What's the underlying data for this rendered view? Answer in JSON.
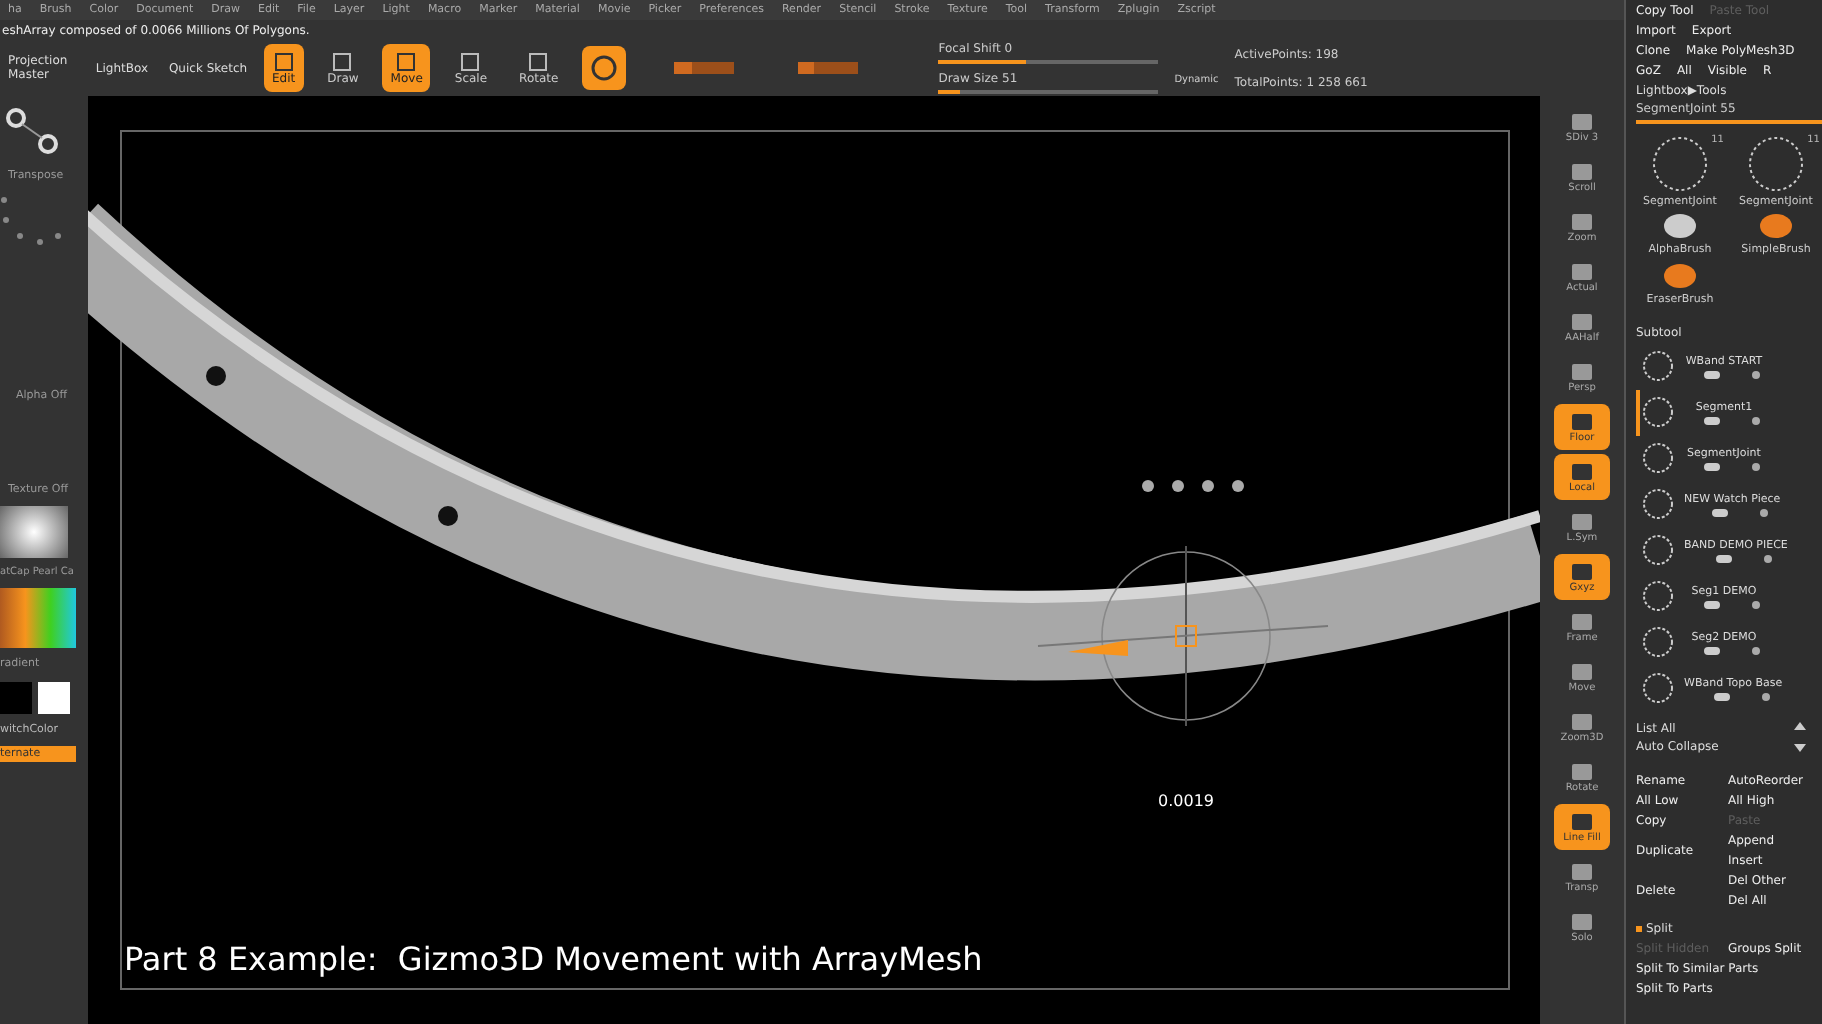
{
  "menu": [
    "ha",
    "Brush",
    "Color",
    "Document",
    "Draw",
    "Edit",
    "File",
    "Layer",
    "Light",
    "Macro",
    "Marker",
    "Material",
    "Movie",
    "Picker",
    "Preferences",
    "Render",
    "Stencil",
    "Stroke",
    "Texture",
    "Tool",
    "Transform",
    "Zplugin",
    "Zscript"
  ],
  "info_line": "eshArray composed of 0.0066 Millions Of Polygons.",
  "toolbar": {
    "projection_master": "Projection Master",
    "lightbox": "LightBox",
    "quick_sketch": "Quick Sketch",
    "modes": [
      {
        "label": "Edit",
        "selected": true
      },
      {
        "label": "Draw",
        "selected": false
      },
      {
        "label": "Move",
        "selected": true
      },
      {
        "label": "Scale",
        "selected": false
      },
      {
        "label": "Rotate",
        "selected": false
      }
    ],
    "rgb_slider": {
      "level": 0.3
    },
    "intensity_slider": {
      "level": 0.25
    },
    "focal_shift": {
      "label": "Focal Shift 0",
      "level": 0.4
    },
    "draw_size": {
      "label": "Draw Size 51",
      "level": 0.1
    },
    "dynamic": "Dynamic",
    "active_points": "ActivePoints: 198",
    "total_points": "TotalPoints: 1 258 661"
  },
  "left_panel": {
    "transpose": "Transpose",
    "alpha": "Alpha Off",
    "texture": "Texture Off",
    "material": "atCap Pearl Ca",
    "gradient": "radient",
    "switch_color": "witchColor",
    "alternate": "ternate"
  },
  "canvas": {
    "readout": "0.0019",
    "caption": "Part 8 Example:  Gizmo3D Movement with ArrayMesh"
  },
  "shelf": [
    {
      "label": "SDiv 3",
      "on": false
    },
    {
      "label": "Scroll",
      "on": false
    },
    {
      "label": "Zoom",
      "on": false
    },
    {
      "label": "Actual",
      "on": false
    },
    {
      "label": "AAHalf",
      "on": false
    },
    {
      "label": "Persp",
      "on": false
    },
    {
      "label": "Floor",
      "on": true
    },
    {
      "label": "Local",
      "on": true
    },
    {
      "label": "L.Sym",
      "on": false
    },
    {
      "label": "Gxyz",
      "on": true
    },
    {
      "label": "Frame",
      "on": false
    },
    {
      "label": "Move",
      "on": false
    },
    {
      "label": "Zoom3D",
      "on": false
    },
    {
      "label": "Rotate",
      "on": false
    },
    {
      "label": "Line Fill",
      "on": true
    },
    {
      "label": "Transp",
      "on": false
    },
    {
      "label": "Solo",
      "on": false
    }
  ],
  "tool_panel": {
    "rows": [
      [
        {
          "label": "Copy Tool",
          "disabled": false
        },
        {
          "label": "Paste Tool",
          "disabled": true
        }
      ],
      [
        {
          "label": "Import",
          "disabled": false
        },
        {
          "label": "Export",
          "disabled": false
        }
      ],
      [
        {
          "label": "Clone",
          "disabled": false
        },
        {
          "label": "Make PolyMesh3D",
          "disabled": false
        }
      ],
      [
        {
          "label": "GoZ",
          "disabled": false
        },
        {
          "label": "All",
          "disabled": false
        },
        {
          "label": "Visible",
          "disabled": false
        },
        {
          "label": "R",
          "disabled": false
        }
      ]
    ],
    "lightbox": "Lightbox▶Tools",
    "segment_slider": {
      "label": "SegmentJoint  55",
      "level": 0.85
    },
    "brushes": [
      {
        "label": "SegmentJoint",
        "count": "11"
      },
      {
        "label": "SegmentJoint",
        "count": "11"
      },
      {
        "label": "AlphaBrush"
      },
      {
        "label": "SimpleBrush"
      },
      {
        "label": "EraserBrush"
      }
    ]
  },
  "subtool": {
    "title": "Subtool",
    "items": [
      {
        "name": "WBand START",
        "selected": false
      },
      {
        "name": "Segment1",
        "selected": true
      },
      {
        "name": "SegmentJoint",
        "selected": false
      },
      {
        "name": "NEW Watch Piece",
        "selected": false
      },
      {
        "name": "BAND DEMO PIECE",
        "selected": false
      },
      {
        "name": "Seg1 DEMO",
        "selected": false
      },
      {
        "name": "Seg2 DEMO",
        "selected": false
      },
      {
        "name": "WBand Topo Base",
        "selected": false
      }
    ],
    "list_all": "List All",
    "auto_collapse": "Auto Collapse",
    "actions": [
      {
        "left": {
          "label": "Rename",
          "disabled": false
        },
        "right": [
          {
            "label": "AutoReorder",
            "disabled": false
          }
        ]
      },
      {
        "left": {
          "label": "All Low",
          "disabled": false
        },
        "right": [
          {
            "label": "All High",
            "disabled": false
          }
        ]
      },
      {
        "left": {
          "label": "Copy",
          "disabled": false
        },
        "right": [
          {
            "label": "Paste",
            "disabled": true
          }
        ]
      },
      {
        "left": {
          "label": "Duplicate",
          "disabled": false
        },
        "right": [
          {
            "label": "Append",
            "disabled": false
          },
          {
            "label": "Insert",
            "disabled": false
          }
        ]
      },
      {
        "left": {
          "label": "Delete",
          "disabled": false
        },
        "right": [
          {
            "label": "Del Other",
            "disabled": false
          },
          {
            "label": "Del All",
            "disabled": false
          }
        ]
      }
    ],
    "split": "Split",
    "split_rows": [
      [
        {
          "label": "Split Hidden",
          "disabled": true
        },
        {
          "label": "Groups Split",
          "disabled": false
        }
      ],
      [
        {
          "label": "Split To Similar Parts",
          "disabled": false
        }
      ],
      [
        {
          "label": "Split To Parts",
          "disabled": false
        }
      ]
    ]
  }
}
